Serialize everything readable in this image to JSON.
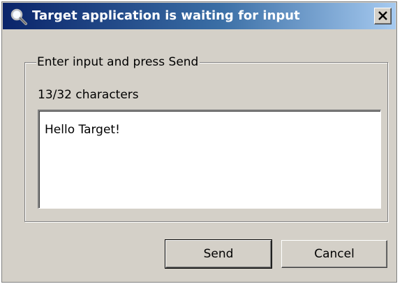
{
  "window": {
    "title": "Target application is waiting for input",
    "title_icon": "magnifier-icon",
    "close_icon": "close-icon"
  },
  "group": {
    "legend": "Enter input and press Send",
    "char_count": "13/32 characters",
    "input_value": "Hello Target!"
  },
  "buttons": {
    "send_label": "Send",
    "cancel_label": "Cancel"
  },
  "colors": {
    "titlebar_start": "#0a246a",
    "titlebar_end": "#a6caf0",
    "face": "#d4d0c8"
  }
}
